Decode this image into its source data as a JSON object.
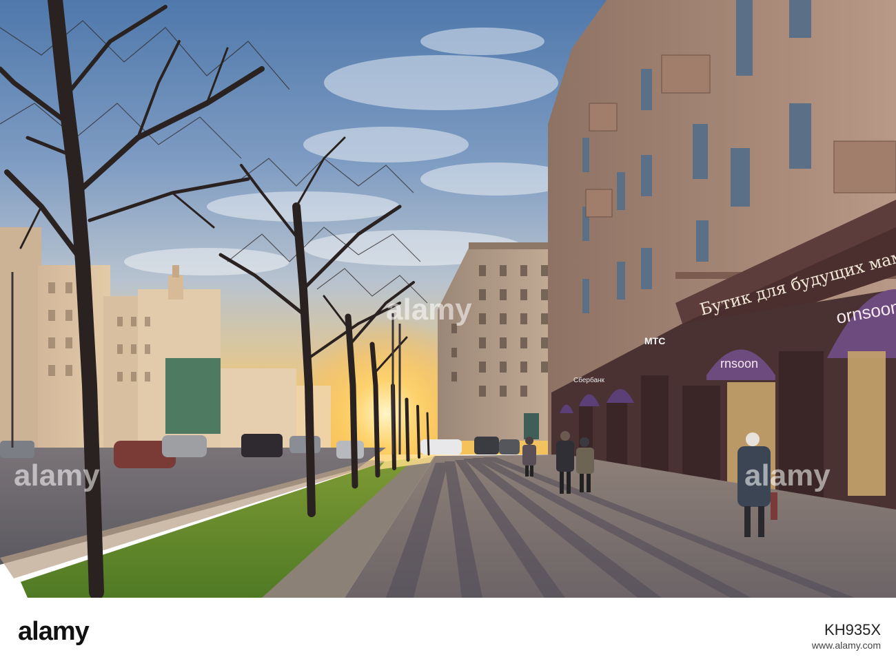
{
  "photo": {
    "shop_sign": "Бутик для будущих мам",
    "storefront_sign": "ornsoon",
    "storefront_sign_2": "rnsoon",
    "store_sign_mts": "МТС",
    "bank_sign": "Сбербанк",
    "colors": {
      "sky_top": "#5d84b4",
      "sky_mid": "#9fb4cc",
      "horizon_glow": "#f7c866",
      "facade": "#b69a88",
      "granite": "#4a3232",
      "awning": "#6e4b7e",
      "grass": "#5f8a2a",
      "pavement": "#7a6f70"
    }
  },
  "watermark": {
    "logo_text": "alamy",
    "image_id": "KH935X",
    "url": "www.alamy.com"
  }
}
